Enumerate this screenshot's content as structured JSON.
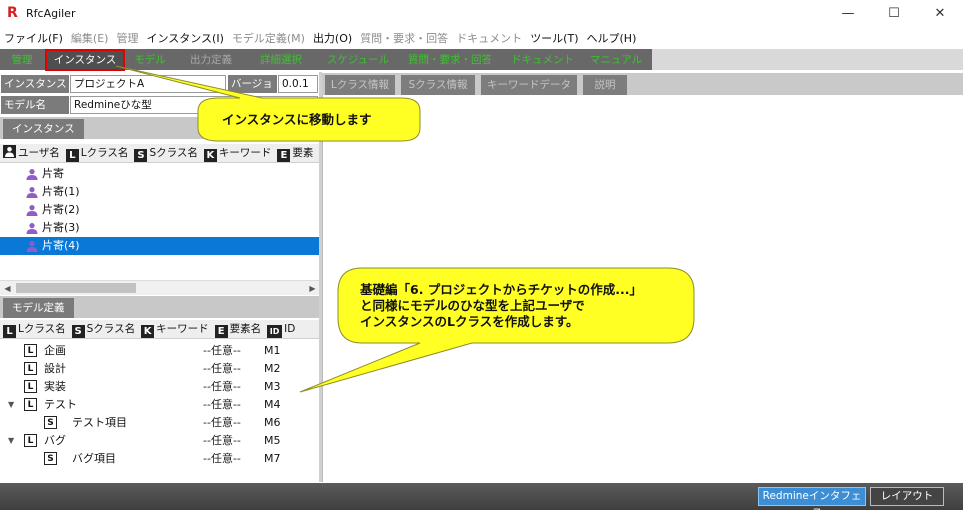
{
  "window": {
    "title": "RfcAgiler",
    "app_icon": "R",
    "minimize": "—",
    "maximize": "☐",
    "close": "✕"
  },
  "menu": [
    {
      "label": "ファイル(F)",
      "enabled": true
    },
    {
      "label": "編集(E)",
      "enabled": false
    },
    {
      "label": "管理",
      "enabled": false
    },
    {
      "label": "インスタンス(I)",
      "enabled": true
    },
    {
      "label": "モデル定義(M)",
      "enabled": false
    },
    {
      "label": "出力(O)",
      "enabled": true
    },
    {
      "label": "質問・要求・回答",
      "enabled": false
    },
    {
      "label": "ドキュメント",
      "enabled": false
    },
    {
      "label": "ツール(T)",
      "enabled": true
    },
    {
      "label": "ヘルプ(H)",
      "enabled": true
    }
  ],
  "main_tabs": [
    {
      "label": "管理",
      "style": "green"
    },
    {
      "label": "インスタンス",
      "style": "active"
    },
    {
      "label": "モデル",
      "style": "green"
    },
    {
      "label": "出力定義",
      "style": "gray"
    },
    {
      "label": "詳細選択",
      "style": "green"
    },
    {
      "label": "スケジュール",
      "style": "green"
    },
    {
      "label": "質問・要求・回答",
      "style": "green"
    },
    {
      "label": "ドキュメント",
      "style": "green"
    },
    {
      "label": "マニュアル",
      "style": "green"
    }
  ],
  "instance_form": {
    "instance_label": "インスタンス名",
    "instance_value": "プロジェクトA",
    "version_label": "バージョン",
    "version_value": "0.0.1",
    "model_label": "モデル名",
    "model_value": "Redmineひな型"
  },
  "instance_panel": {
    "tab": "インスタンス",
    "columns": [
      {
        "badge": "person",
        "label": "ユーザ名"
      },
      {
        "badge": "L",
        "label": "Lクラス名"
      },
      {
        "badge": "S",
        "label": "Sクラス名"
      },
      {
        "badge": "K",
        "label": "キーワード"
      },
      {
        "badge": "E",
        "label": "要素"
      }
    ],
    "users": [
      "片寄",
      "片寄(1)",
      "片寄(2)",
      "片寄(3)",
      "片寄(4)"
    ],
    "selected_index": 4
  },
  "model_panel": {
    "tab": "モデル定義",
    "columns": [
      {
        "badge": "L",
        "label": "Lクラス名"
      },
      {
        "badge": "S",
        "label": "Sクラス名"
      },
      {
        "badge": "K",
        "label": "キーワード"
      },
      {
        "badge": "E",
        "label": "要素名"
      },
      {
        "badge": "ID",
        "label": "ID"
      }
    ],
    "rows": [
      {
        "type": "L",
        "name": "企画",
        "option": "--任意--",
        "id": "M1",
        "expanded": null
      },
      {
        "type": "L",
        "name": "設計",
        "option": "--任意--",
        "id": "M2",
        "expanded": null
      },
      {
        "type": "L",
        "name": "実装",
        "option": "--任意--",
        "id": "M3",
        "expanded": null
      },
      {
        "type": "L",
        "name": "テスト",
        "option": "--任意--",
        "id": "M4",
        "expanded": true
      },
      {
        "type": "S",
        "name": "テスト項目",
        "option": "--任意--",
        "id": "M6",
        "expanded": null
      },
      {
        "type": "L",
        "name": "バグ",
        "option": "--任意--",
        "id": "M5",
        "expanded": true
      },
      {
        "type": "S",
        "name": "バグ項目",
        "option": "--任意--",
        "id": "M7",
        "expanded": null
      }
    ]
  },
  "right_tabs": [
    "Lクラス情報",
    "Sクラス情報",
    "キーワードデータ",
    "説明"
  ],
  "status": {
    "redmine_button": "Redmineインタフェース",
    "layout_button": "レイアウト"
  },
  "callouts": {
    "first": "インスタンスに移動します",
    "second_line1": "基礎編「6. プロジェクトからチケットの作成...」",
    "second_line2": "と同様にモデルのひな型を上記ユーザで",
    "second_line3": "インスタンスのLクラスを作成します。"
  },
  "colors": {
    "toolbar_bg": "#686868",
    "green_tab": "#39c62a",
    "active_border": "#e30000",
    "selection": "#0a78d7",
    "callout_fill": "#ffff24",
    "person_icon": "#8f5cc9"
  }
}
